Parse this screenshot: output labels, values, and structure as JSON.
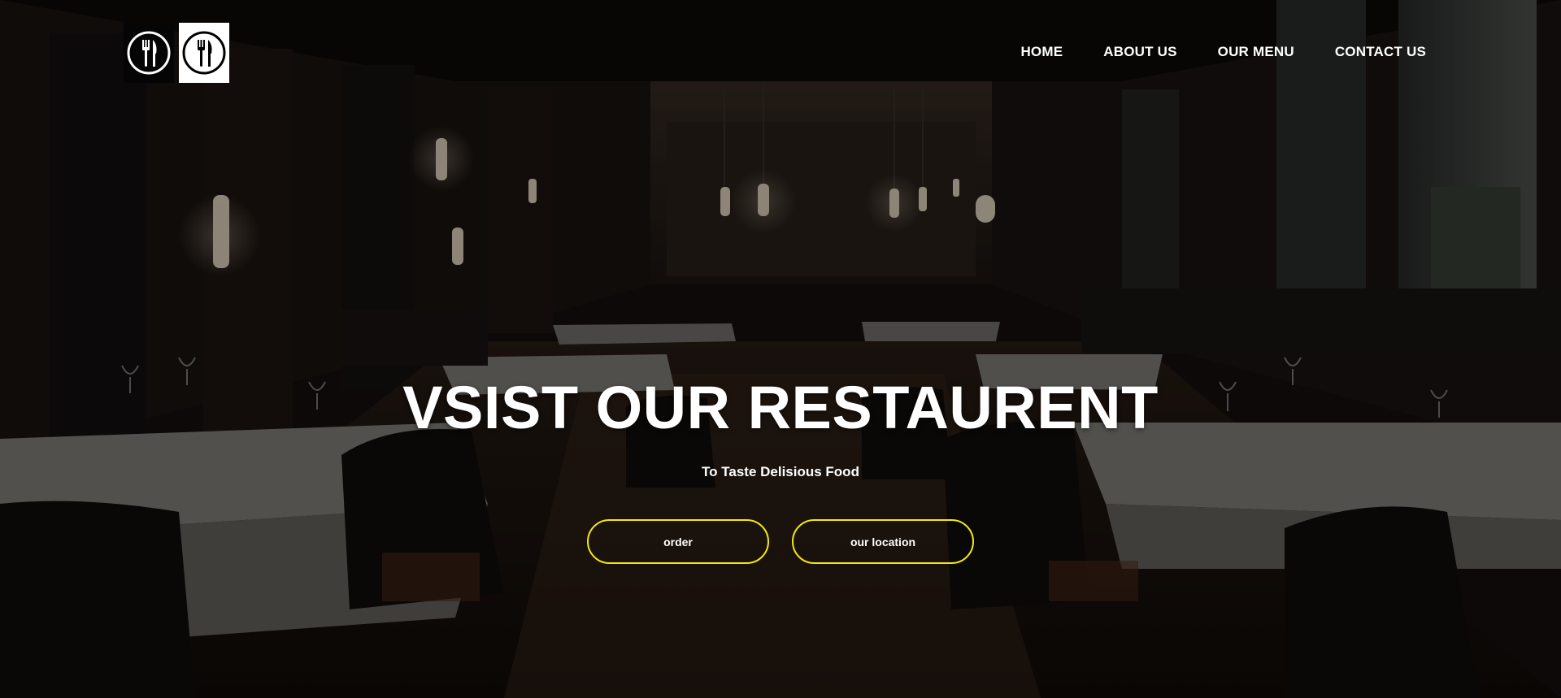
{
  "brand": {
    "logo_icons": [
      "fork-knife-icon",
      "fork-knife-icon"
    ]
  },
  "nav": {
    "items": [
      {
        "label": "HOME"
      },
      {
        "label": "ABOUT US"
      },
      {
        "label": "OUR MENU"
      },
      {
        "label": "CONTACT US"
      }
    ]
  },
  "hero": {
    "title": "VSIST OUR RESTAURENT",
    "subtitle": "To Taste Delisious Food",
    "buttons": [
      {
        "label": "order"
      },
      {
        "label": "our location"
      }
    ]
  },
  "colors": {
    "accent": "#f5e80b",
    "text": "#ffffff",
    "background": "#0a0908"
  }
}
